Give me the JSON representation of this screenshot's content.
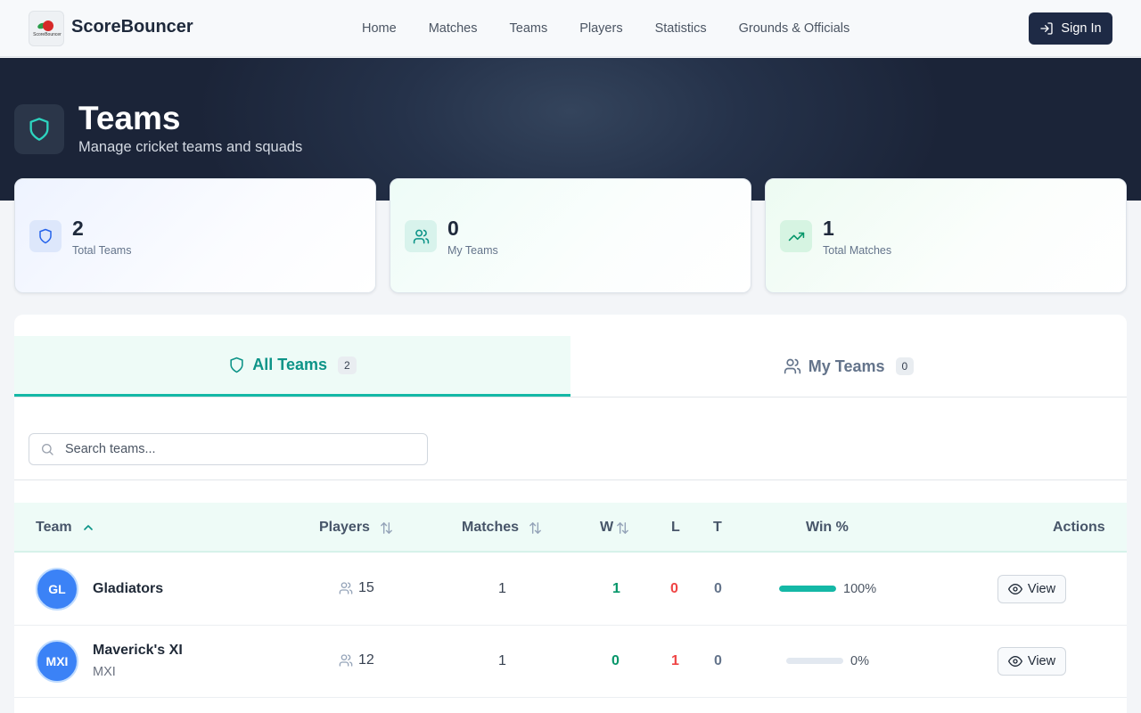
{
  "nav": {
    "logo_text": "ScoreBouncer",
    "brand": "ScoreBouncer",
    "links": [
      "Home",
      "Matches",
      "Teams",
      "Players",
      "Statistics",
      "Grounds & Officials"
    ],
    "signin_label": "Sign In"
  },
  "hero": {
    "title": "Teams",
    "subtitle": "Manage cricket teams and squads"
  },
  "stats": [
    {
      "value": "2",
      "label": "Total Teams",
      "icon": "shield-icon"
    },
    {
      "value": "0",
      "label": "My Teams",
      "icon": "users-icon"
    },
    {
      "value": "1",
      "label": "Total Matches",
      "icon": "trending-up-icon"
    }
  ],
  "tabs": [
    {
      "label": "All Teams",
      "count": "2",
      "active": true
    },
    {
      "label": "My Teams",
      "count": "0",
      "active": false
    }
  ],
  "search": {
    "placeholder": "Search teams..."
  },
  "table": {
    "headers": {
      "team": "Team",
      "players": "Players",
      "matches": "Matches",
      "w": "W",
      "l": "L",
      "t": "T",
      "win_pct": "Win %",
      "actions": "Actions"
    },
    "rows": [
      {
        "initials": "GL",
        "name": "Gladiators",
        "abbr": "",
        "players": "15",
        "matches": "1",
        "w": "1",
        "l": "0",
        "t": "0",
        "win_pct_label": "100%",
        "win_fraction": 1.0,
        "action": "View"
      },
      {
        "initials": "MXI",
        "name": "Maverick's XI",
        "abbr": "MXI",
        "players": "12",
        "matches": "1",
        "w": "0",
        "l": "1",
        "t": "0",
        "win_pct_label": "0%",
        "win_fraction": 0.0,
        "action": "View"
      }
    ]
  },
  "colors": {
    "accent": "#14b8a6",
    "navy": "#1e2a45",
    "avatar": "#3b82f6",
    "win": "#059669",
    "loss": "#ef4444"
  }
}
